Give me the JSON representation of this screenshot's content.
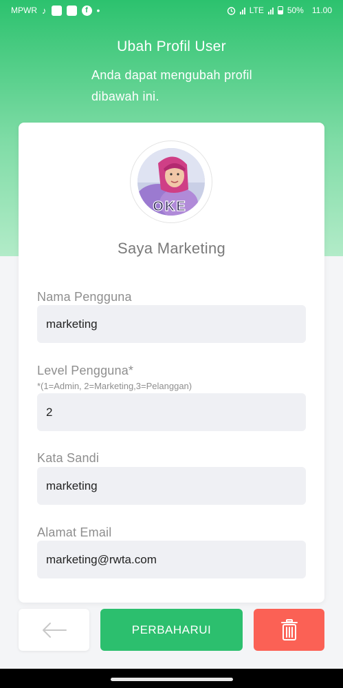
{
  "status_bar": {
    "carrier": "MPWR",
    "network": "LTE",
    "battery": "50%",
    "time": "11.00",
    "icons": [
      "tiktok-icon",
      "app-icon",
      "app-icon",
      "facebook-icon",
      "alarm-icon",
      "signal-icon",
      "battery-icon"
    ]
  },
  "header": {
    "title": "Ubah Profil User",
    "subtitle": "Anda dapat mengubah profil dibawah ini."
  },
  "profile": {
    "display_name": "Saya Marketing",
    "avatar_caption": "OKE"
  },
  "form": {
    "username": {
      "label": "Nama Pengguna",
      "value": "marketing"
    },
    "level": {
      "label": "Level Pengguna*",
      "hint": "*(1=Admin, 2=Marketing,3=Pelanggan)",
      "value": "2"
    },
    "password": {
      "label": "Kata Sandi",
      "value": "marketing"
    },
    "email": {
      "label": "Alamat Email",
      "value": "marketing@rwta.com"
    }
  },
  "actions": {
    "back_icon": "arrow-left-icon",
    "update_label": "PERBAHARUI",
    "delete_icon": "trash-icon"
  },
  "colors": {
    "primary": "#2cbf6e",
    "danger": "#fb6155"
  }
}
